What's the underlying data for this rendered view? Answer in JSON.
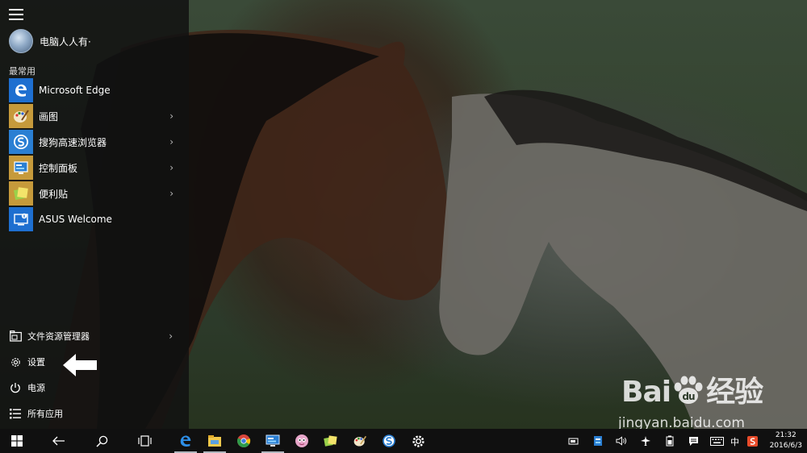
{
  "start_menu": {
    "user_name": "电脑人人有·",
    "section_label": "最常用",
    "apps": [
      {
        "label": "Microsoft Edge",
        "icon": "edge-icon",
        "color": "#1e6fd0",
        "has_chevron": false
      },
      {
        "label": "画图",
        "icon": "paint-icon",
        "color": "#c69a3b",
        "has_chevron": true
      },
      {
        "label": "搜狗高速浏览器",
        "icon": "sogou-browser-icon",
        "color": "#2a7fd3",
        "has_chevron": true
      },
      {
        "label": "控制面板",
        "icon": "control-panel-icon",
        "color": "#c69a3b",
        "has_chevron": true
      },
      {
        "label": "便利贴",
        "icon": "sticky-notes-icon",
        "color": "#c69a3b",
        "has_chevron": true
      },
      {
        "label": "ASUS Welcome",
        "icon": "asus-welcome-icon",
        "color": "#1e6fd0",
        "has_chevron": false
      }
    ],
    "bottom": {
      "file_explorer": "文件资源管理器",
      "settings": "设置",
      "power": "电源",
      "all_apps": "所有应用"
    }
  },
  "watermark": {
    "brand": "Bai",
    "brand_suffix": "经验",
    "url": "jingyan.baidu.com"
  },
  "taskbar": {
    "apps": [
      "edge-icon",
      "file-explorer-icon",
      "chrome-icon",
      "control-panel-icon",
      "qq-pet-icon",
      "sticky-notes-icon",
      "paint-icon",
      "sogou-browser-icon",
      "settings-icon"
    ],
    "ime_label": "中",
    "time": "21:32",
    "date": "2016/6/3"
  }
}
